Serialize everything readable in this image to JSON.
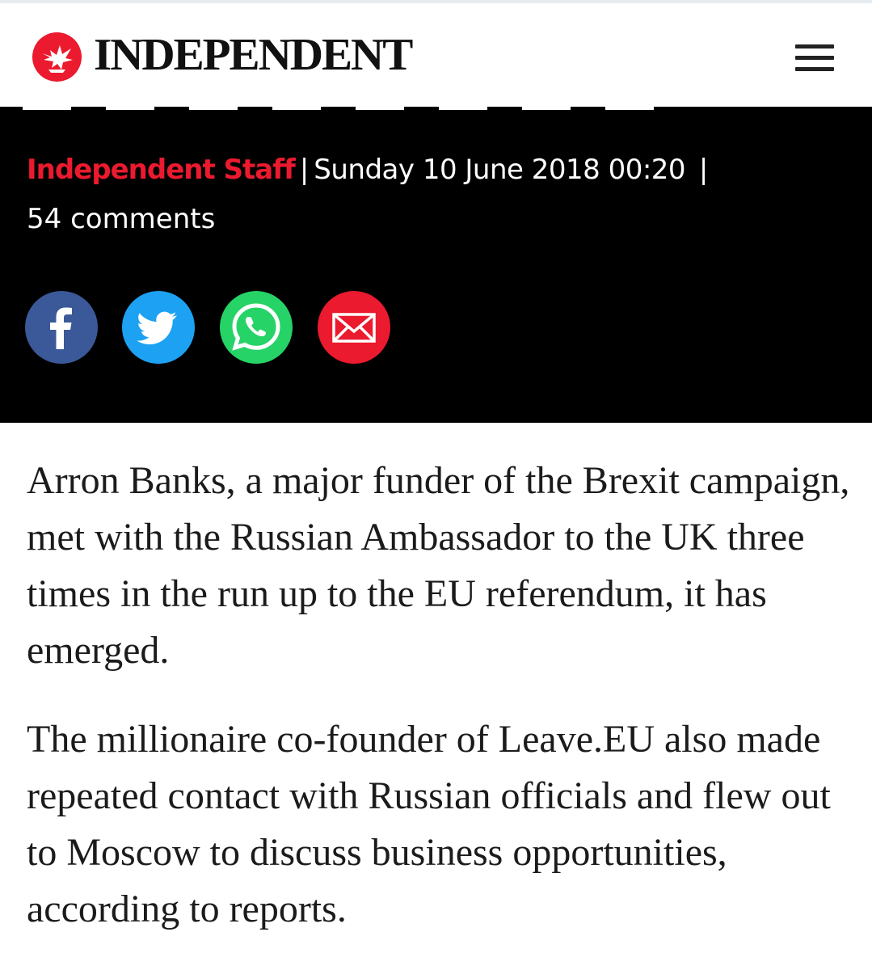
{
  "header": {
    "logo_text": "INDEPENDENT",
    "logo_icon": "eagle-logo-icon",
    "menu_icon": "hamburger-menu-icon"
  },
  "byline": {
    "author": "Independent Staff",
    "separator": "|",
    "date": "Sunday 10 June 2018 00:20",
    "comments": "54 comments"
  },
  "share": {
    "buttons": [
      {
        "name": "facebook",
        "icon": "facebook-icon",
        "color": "#3b5998"
      },
      {
        "name": "twitter",
        "icon": "twitter-icon",
        "color": "#1da1f2"
      },
      {
        "name": "whatsapp",
        "icon": "whatsapp-icon",
        "color": "#25d366"
      },
      {
        "name": "email",
        "icon": "email-icon",
        "color": "#ec1a2e"
      }
    ]
  },
  "article": {
    "paragraphs": [
      "Arron Banks, a major funder of the Brexit campaign, met with the Russian Ambassador to the UK three times in the run up to the EU referendum, it has emerged.",
      "The millionaire co-founder of Leave.EU also made repeated contact with Russian officials and flew out to Moscow to discuss business opportunities, according to reports."
    ]
  },
  "colors": {
    "brand_red": "#ec1a2e",
    "band_background": "#000000",
    "text": "#1b1b1b"
  }
}
